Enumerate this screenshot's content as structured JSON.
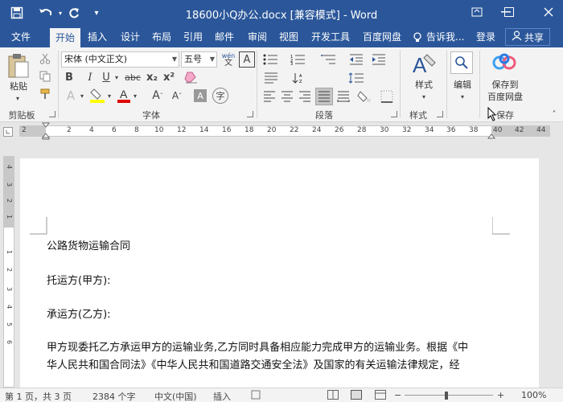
{
  "titlebar": {
    "title": "18600小Q办公.docx [兼容模式] - Word",
    "save_icon": "save-icon",
    "undo_icon": "undo-icon",
    "redo_icon": "redo-icon",
    "customize_icon": "customize-qat-icon"
  },
  "tabs": [
    "文件",
    "开始",
    "插入",
    "设计",
    "布局",
    "引用",
    "邮件",
    "审阅",
    "视图",
    "开发工具",
    "百度网盘"
  ],
  "active_tab": "开始",
  "tell_me": "告诉我...",
  "login": "登录",
  "share": "共享",
  "ribbon": {
    "clipboard": {
      "paste": "粘贴",
      "label": "剪贴板"
    },
    "font": {
      "font_name": "宋体 (中文正文)",
      "font_size": "五号",
      "bold": "B",
      "italic": "I",
      "underline": "U",
      "strike": "abc",
      "subscript": "x₂",
      "superscript": "x²",
      "font_size_up": "A",
      "font_size_down": "A",
      "wen": "wén",
      "phonetic_char": "文",
      "label": "字体"
    },
    "paragraph": {
      "label": "段落"
    },
    "styles": {
      "button": "样式",
      "label": "样式"
    },
    "editing": {
      "button": "编辑"
    },
    "save": {
      "button_line1": "保存到",
      "button_line2": "百度网盘",
      "label": "保存"
    }
  },
  "ruler": {
    "ticks": [
      "2",
      "2",
      "4",
      "6",
      "8",
      "10",
      "12",
      "14",
      "16",
      "18",
      "20",
      "22",
      "24",
      "26",
      "28",
      "30",
      "32",
      "34",
      "36",
      "38",
      "40",
      "42",
      "44"
    ]
  },
  "vruler": {
    "ticks": [
      "4",
      "3",
      "2",
      "1",
      "1",
      "2",
      "3",
      "4",
      "5",
      "6"
    ]
  },
  "document": {
    "lines": [
      "公路货物运输合同",
      "托运方(甲方):",
      "承运方(乙方):",
      "甲方现委托乙方承运甲方的运输业务,乙方同时具备相应能力完成甲方的运输业务。根据《中",
      "华人民共和国合同法》《中华人民共和国道路交通安全法》及国家的有关运输法律规定，经"
    ]
  },
  "status": {
    "page": "第 1 页，共 3 页",
    "words": "2384 个字",
    "language": "中文(中国)",
    "mode": "插入",
    "zoom": "100%"
  },
  "colors": {
    "accent": "#2b579a",
    "highlight": "#ffff00",
    "font_color": "#e00000"
  }
}
